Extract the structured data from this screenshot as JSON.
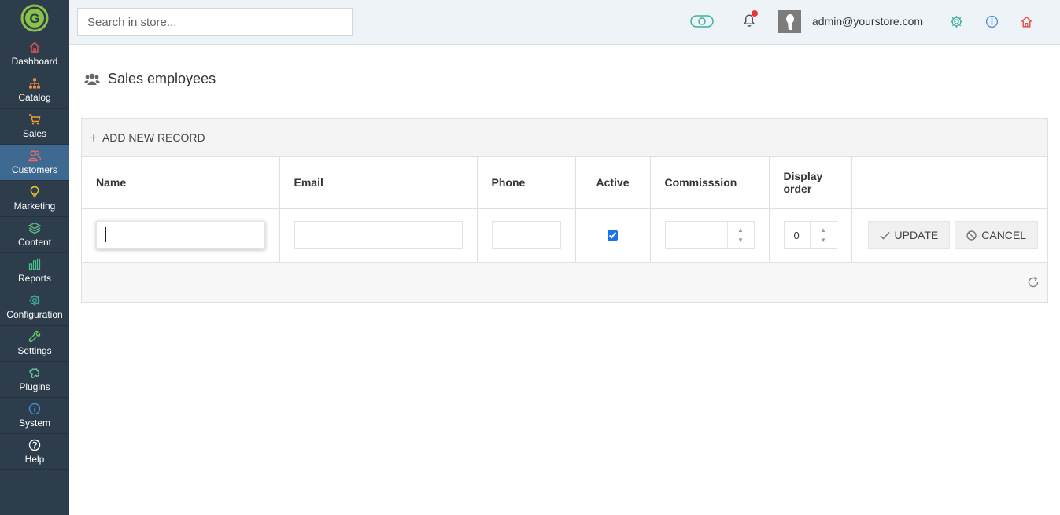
{
  "sidebar": {
    "logo_icon": "g-logo-icon",
    "items": [
      {
        "label": "Dashboard",
        "icon": "home-icon",
        "color": "#e5534b"
      },
      {
        "label": "Catalog",
        "icon": "sitemap-icon",
        "color": "#f08a3e"
      },
      {
        "label": "Sales",
        "icon": "cart-icon",
        "color": "#f0a030"
      },
      {
        "label": "Customers",
        "icon": "users-icon",
        "color": "#f06a5a",
        "active": true
      },
      {
        "label": "Marketing",
        "icon": "bulb-icon",
        "color": "#f2c230"
      },
      {
        "label": "Content",
        "icon": "layers-icon",
        "color": "#5cc08a"
      },
      {
        "label": "Reports",
        "icon": "bar-chart-icon",
        "color": "#4cc08a"
      },
      {
        "label": "Configuration",
        "icon": "gear-icon",
        "color": "#3fb0a0"
      },
      {
        "label": "Settings",
        "icon": "wrench-icon",
        "color": "#66cc66"
      },
      {
        "label": "Plugins",
        "icon": "puzzle-icon",
        "color": "#6ccfa8"
      },
      {
        "label": "System",
        "icon": "info-icon",
        "color": "#4a90e2"
      },
      {
        "label": "Help",
        "icon": "question-icon",
        "color": "#ffffff"
      }
    ]
  },
  "header": {
    "search_placeholder": "Search in store...",
    "user_email": "admin@yourstore.com",
    "icons": [
      "toggle-icon",
      "bell-icon",
      "gear-icon",
      "info-icon",
      "home-icon"
    ]
  },
  "page": {
    "title": "Sales employees",
    "title_icon": "users-icon"
  },
  "grid": {
    "add_label": "ADD NEW RECORD",
    "columns": [
      "Name",
      "Email",
      "Phone",
      "Active",
      "Commisssion",
      "Display order",
      ""
    ],
    "edit_row": {
      "name": "",
      "email": "",
      "phone": "",
      "active": true,
      "commission": "",
      "display_order": "0"
    },
    "update_label": "UPDATE",
    "cancel_label": "CANCEL"
  }
}
